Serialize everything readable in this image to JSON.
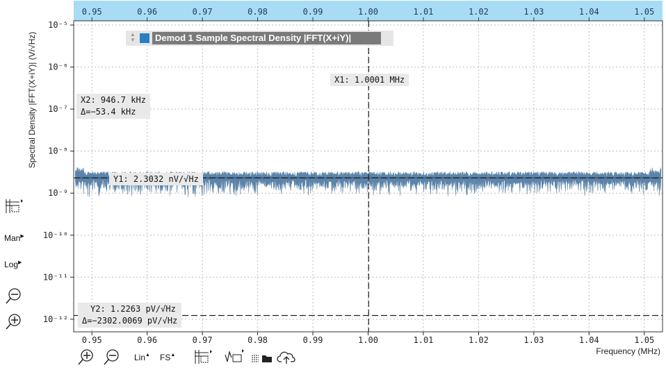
{
  "chart_data": {
    "type": "line",
    "title": "",
    "xlabel": "Frequency (MHz)",
    "ylabel": "Spectral Density |FFT(X+iY)| (V/√Hz)",
    "x_range": [
      0.9467,
      1.0533
    ],
    "y_scale": "log",
    "y_range_exponent": [
      -12.3,
      -4.9
    ],
    "x_ticks": [
      "0.95",
      "0.96",
      "0.97",
      "0.98",
      "0.99",
      "1.00",
      "1.01",
      "1.02",
      "1.03",
      "1.04",
      "1.05"
    ],
    "x_tick_values": [
      0.95,
      0.96,
      0.97,
      0.98,
      0.99,
      1.0,
      1.01,
      1.02,
      1.03,
      1.04,
      1.05
    ],
    "y_ticks": [
      "10⁻⁵",
      "10⁻⁶",
      "10⁻⁷",
      "10⁻⁸",
      "10⁻⁹",
      "10⁻¹⁰",
      "10⁻¹¹",
      "10⁻¹²"
    ],
    "y_tick_exponents": [
      -5,
      -6,
      -7,
      -8,
      -9,
      -10,
      -11,
      -12
    ],
    "grid": true,
    "series": [
      {
        "name": "Demod 1 Sample Spectral Density |FFT(X+iY)|",
        "color": "#4f7aa3",
        "x": [
          0.947,
          1.053
        ],
        "y": [
          2.3e-09,
          2.3e-09
        ],
        "noise": "broadband fluctuation around 2.3 nV/√Hz"
      }
    ],
    "cursors": {
      "x1": {
        "value": 1.0001,
        "label": "X1: 1.0001 MHz"
      },
      "x2": {
        "value": 0.9467,
        "label": "X2: 946.7 kHz",
        "delta": "Δ=−53.4 kHz"
      },
      "y1": {
        "value": 2.3032e-09,
        "label": "Y1: 2.3032 nV/√Hz"
      },
      "y2": {
        "value": 1.2263e-12,
        "label": "Y2: 1.2263 pV/√Hz",
        "delta": "Δ=−2302.0069 pV/√Hz"
      }
    }
  },
  "legend": {
    "label": "Demod 1 Sample Spectral Density |FFT(X+iY)|",
    "color": "#2a7fc4"
  },
  "side_controls": {
    "man": "Man",
    "log": "Log"
  },
  "bottom_controls": {
    "lin": "Lin",
    "fs": "FS"
  },
  "colors": {
    "top_axis_bg": "#a8dcf5",
    "plot_border": "#333333",
    "grid": "#bdbdbd",
    "trace": "#4f7aa3",
    "cursor": "#222222"
  }
}
